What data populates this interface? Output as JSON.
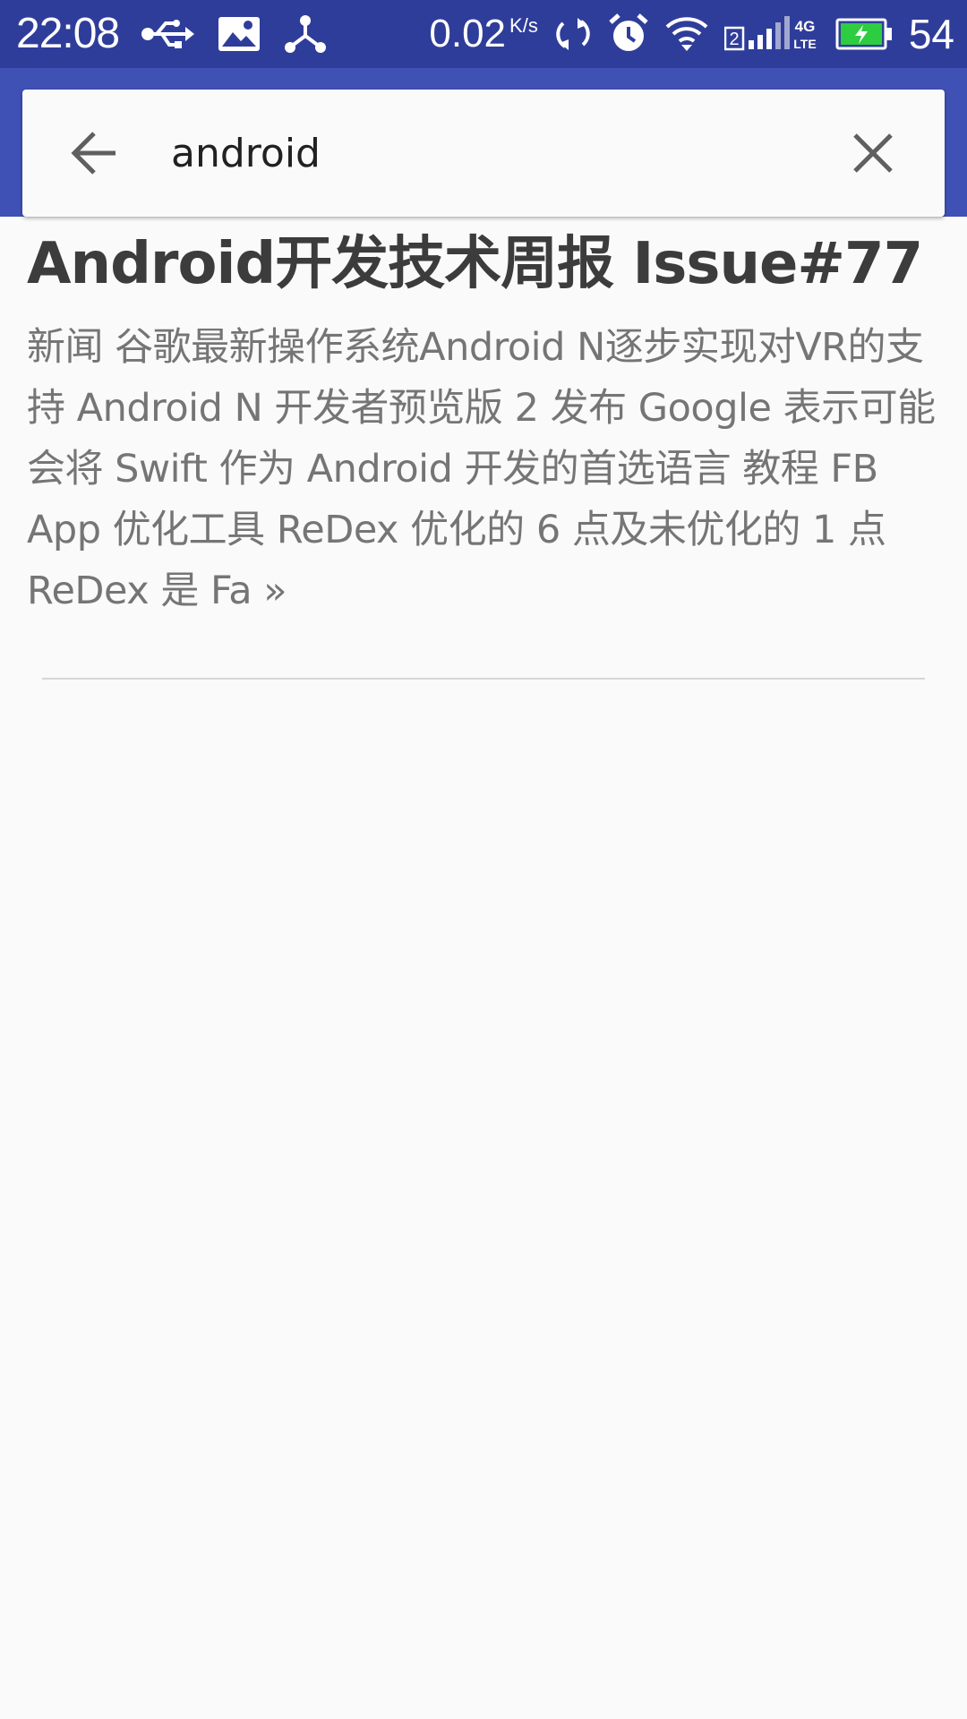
{
  "status_bar": {
    "time": "22:08",
    "net_speed": "0.02",
    "net_unit": "K/s",
    "sim_slot": "2",
    "network_type": "4G LTE",
    "battery_percent": "54",
    "icons": [
      "usb-icon",
      "image-icon",
      "share-icon",
      "sync-icon",
      "alarm-icon",
      "wifi-icon",
      "signal-icon",
      "battery-charging-icon"
    ],
    "background_color": "#2f3d9a"
  },
  "app_bar": {
    "background_color": "#3f51b5"
  },
  "search": {
    "query": "android",
    "back_icon": "arrow-back-icon",
    "clear_icon": "close-icon"
  },
  "results": [
    {
      "title": "Android开发技术周报 Issue#77",
      "excerpt": "新闻 谷歌最新操作系统Android N逐步实现对VR的支持 Android N 开发者预览版 2 发布 Google 表示可能会将 Swift 作为 Android 开发的首选语言 教程 FB App 优化工具 ReDex 优化的 6 点及未优化的 1 点 ReDex 是 Fa »"
    }
  ]
}
